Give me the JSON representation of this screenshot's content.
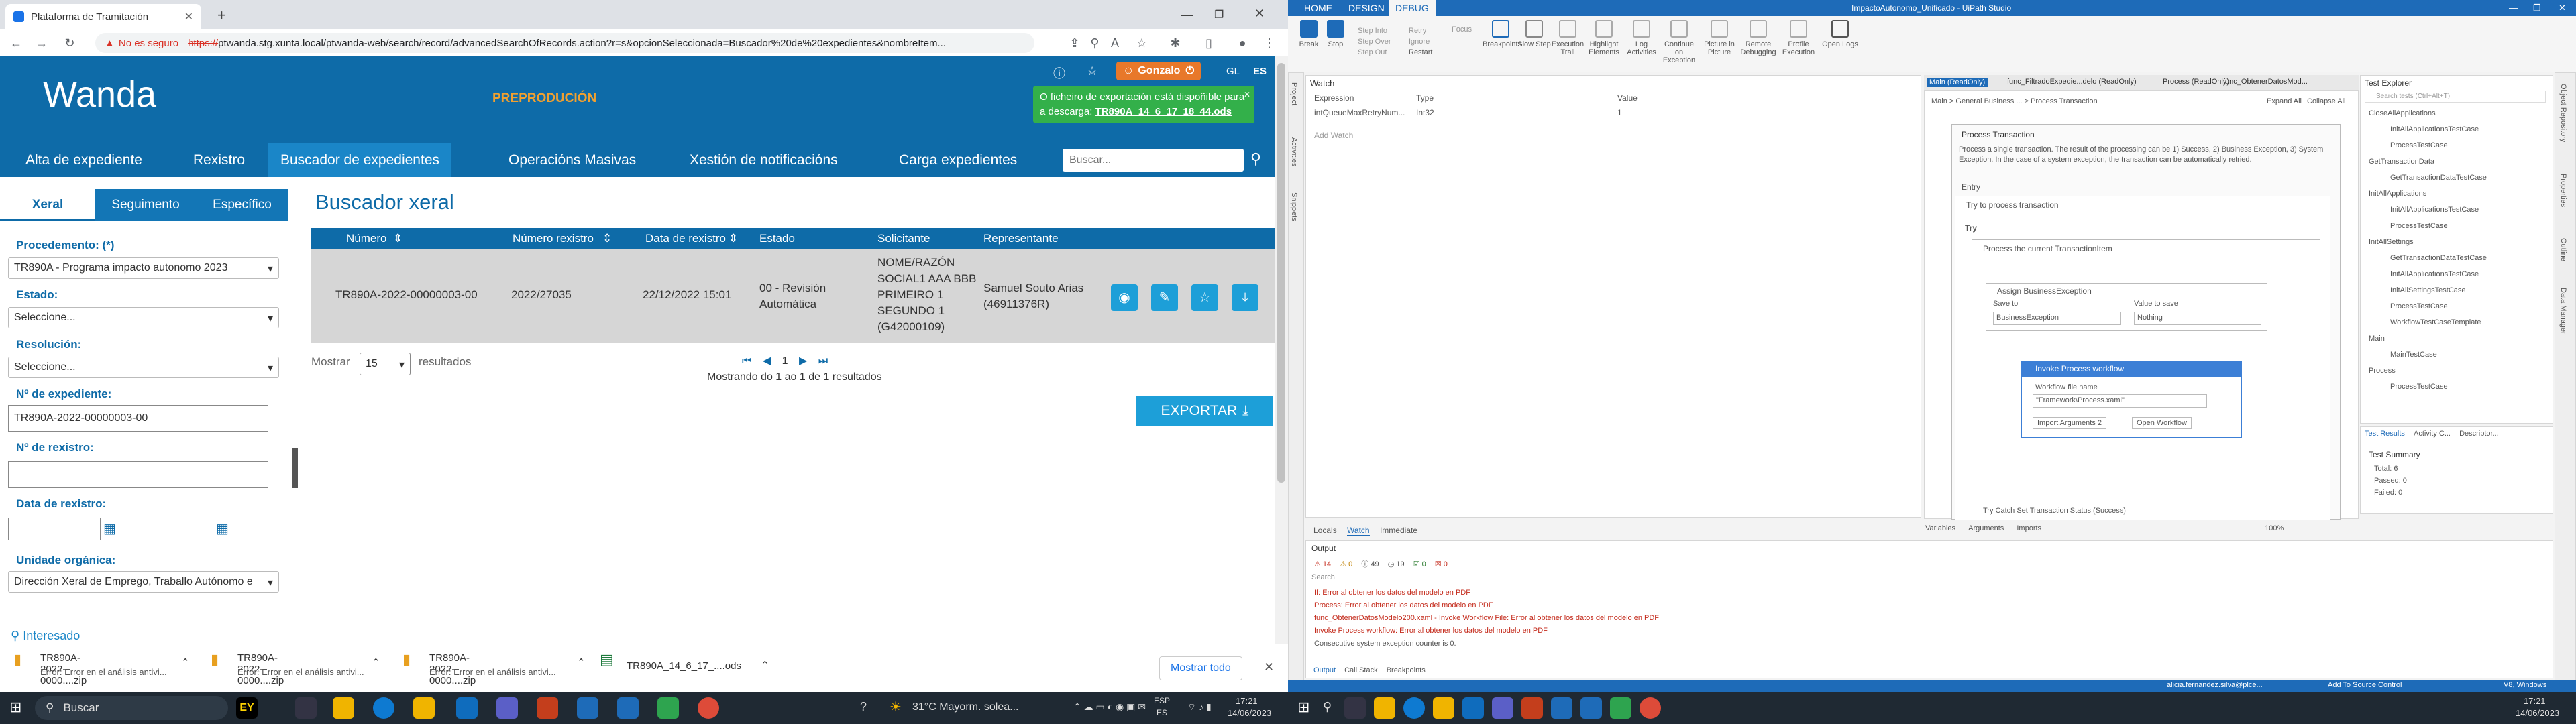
{
  "browser": {
    "tab_title": "Plataforma de Tramitación",
    "not_secure": "No es seguro",
    "url_prefix": "https://",
    "url": "ptwanda.stg.xunta.local/ptwanda-web/search/record/advancedSearchOfRecords.action?r=s&opcionSeleccionada=Buscador%20de%20expedientes&nombreItem..."
  },
  "wanda": {
    "logo": "Wanda",
    "env": "PREPRODUCIÓN",
    "user": "Gonzalo",
    "lang_gl": "GL",
    "lang_es": "ES",
    "notification": {
      "text": "O ficheiro de exportación está dispoñible para a descarga:",
      "file": "TR890A_14_6_17_18_44.ods"
    },
    "nav": [
      "Alta de expediente",
      "Rexistro",
      "Buscador de expedientes",
      "Operacións Masivas",
      "Xestión de notificacións",
      "Carga expedientes"
    ],
    "search_placeholder": "Buscar...",
    "side_tabs": [
      "Xeral",
      "Seguimento",
      "Específico"
    ],
    "filters": {
      "procedimento_label": "Procedemento: (*)",
      "procedimento_value": "TR890A - Programa impacto autonomo 2023",
      "estado_label": "Estado:",
      "estado_value": "Seleccione...",
      "resolucion_label": "Resolución:",
      "resolucion_value": "Seleccione...",
      "expediente_label": "Nº de expediente:",
      "expediente_value": "TR890A-2022-00000003-00",
      "rexistro_label": "Nº de rexistro:",
      "data_label": "Data de rexistro:",
      "unidade_label": "Unidade orgánica:",
      "unidade_value": "Dirección Xeral de Emprego, Traballo Autónomo e",
      "interesado": "Interesado"
    },
    "page_title": "Buscador xeral",
    "table": {
      "headers": [
        "Número",
        "Número rexistro",
        "Data de rexistro",
        "Estado",
        "Solicitante",
        "Representante"
      ],
      "row": {
        "numero": "TR890A-2022-00000003-00",
        "rexistro": "2022/27035",
        "data": "22/12/2022 15:01",
        "estado": "00 - Revisión Automática",
        "solicitante": "NOME/RAZÓN SOCIAL1 AAA BBB PRIMEIRO 1 SEGUNDO 1 (G42000109)",
        "representante": "Samuel Souto Arias (46911376R)"
      }
    },
    "mostrar": "Mostrar",
    "page_size": "15",
    "resultados": "resultados",
    "page_num": "1",
    "showing": "Mostrando do 1 ao 1 de 1 resultados",
    "export": "EXPORTAR"
  },
  "downloads": {
    "items": [
      {
        "name": "TR890A-2022-0000....zip",
        "status": "Error: Error en el análisis antivi..."
      },
      {
        "name": "TR890A-2022-0000....zip",
        "status": "Error: Error en el análisis antivi..."
      },
      {
        "name": "TR890A-2022-0000....zip",
        "status": "Error: Error en el análisis antivi..."
      },
      {
        "name": "TR890A_14_6_17_....ods",
        "status": ""
      }
    ],
    "show_all": "Mostrar todo"
  },
  "studio": {
    "title": "ImpactoAutonomo_Unificado - UiPath Studio",
    "tabs": [
      "HOME",
      "DESIGN",
      "DEBUG"
    ],
    "ribbon": [
      "Break",
      "Stop",
      "Step Into",
      "Step Over",
      "Step Out",
      "Retry",
      "Ignore",
      "Restart",
      "Focus",
      "Breakpoints",
      "Slow Step",
      "Execution Trail",
      "Highlight Elements",
      "Log Activities",
      "Continue on Exception",
      "Picture in Picture",
      "Remote Debugging",
      "Profile Execution",
      "Open Logs"
    ],
    "watch": {
      "title": "Watch",
      "cols": [
        "Expression",
        "Type",
        "Value"
      ],
      "row": [
        "intQueueMaxRetryNum...",
        "Int32",
        "1"
      ],
      "add": "Add Watch"
    },
    "bottom_tabs": [
      "Locals",
      "Watch",
      "Immediate"
    ],
    "doc_tabs": [
      "Main (ReadOnly)",
      "func_FiltradoExpedie...delo (ReadOnly)",
      "Process (ReadOnly)",
      "func_ObtenerDatosMod..."
    ],
    "breadcrumb": [
      "Main",
      "General Business ...",
      "Process Transaction"
    ],
    "expand": "Expand All",
    "collapse": "Collapse All",
    "wf": {
      "title": "Process Transaction",
      "desc": "Process a single transaction. The result of the processing can be 1) Success, 2) Business Exception, 3) System Exception. In the case of a system exception, the transaction can be automatically retried.",
      "entry": "Entry",
      "try_process": "Try to process transaction",
      "try": "Try",
      "process_current": "Process the current TransactionItem",
      "assign": "Assign BusinessException",
      "save_to": "Save to",
      "value_to_save": "Value to save",
      "save_val": "BusinessException",
      "value_val": "Nothing",
      "invoke": "Invoke Process workflow",
      "wf_file": "Workflow file name",
      "wf_path": "\"Framework\\Process.xaml\"",
      "import": "Import Arguments",
      "import_n": "2",
      "open": "Open Workflow",
      "trycatch": "Try Catch Set Transaction Status (Success)"
    },
    "designer_bottom": [
      "Variables",
      "Arguments",
      "Imports"
    ],
    "zoom": "100%",
    "output": {
      "title": "Output",
      "counts": [
        "14",
        "0",
        "49",
        "19",
        "0",
        "0"
      ],
      "search": "Search",
      "lines": [
        "If: Error al obtener los datos del modelo en PDF",
        "Process: Error al obtener los datos del modelo en PDF",
        "func_ObtenerDatosModelo200.xaml - Invoke Workflow File: Error al obtener los datos del modelo en PDF",
        "Invoke Process workflow: Error al obtener los datos del modelo en PDF",
        "Consecutive system exception counter is 0."
      ],
      "tabs": [
        "Output",
        "Call Stack",
        "Breakpoints"
      ]
    },
    "test_explorer": {
      "title": "Test Explorer",
      "search": "Search tests (Ctrl+Alt+T)",
      "tree": [
        "CloseAllApplications",
        "InitAllApplicationsTestCase",
        "ProcessTestCase",
        "GetTransactionData",
        "GetTransactionDataTestCase",
        "InitAllApplications",
        "InitAllApplicationsTestCase",
        "ProcessTestCase",
        "InitAllSettings",
        "GetTransactionDataTestCase",
        "InitAllApplicationsTestCase",
        "InitAllSettingsTestCase",
        "ProcessTestCase",
        "WorkflowTestCaseTemplate",
        "Main",
        "MainTestCase",
        "Process",
        "ProcessTestCase"
      ],
      "tabs": [
        "Test Results",
        "Activity C...",
        "Descriptor..."
      ],
      "summary": "Test Summary",
      "total": "Total: 6",
      "passed": "Passed: 0",
      "failed": "Failed: 0"
    },
    "side_tabs": [
      "Project",
      "Activities",
      "Snippets"
    ],
    "right_tabs": [
      "Object Repository",
      "Properties",
      "Outline",
      "Data Manager"
    ],
    "status": {
      "user": "alicia.fernandez.silva@plce...",
      "source": "Add To Source Control",
      "domain": "V8, Windows"
    }
  },
  "taskbar": {
    "search": "Buscar",
    "weather": "31°C  Mayorm. solea...",
    "lang": "ESP",
    "lang2": "ES",
    "time": "17:21",
    "date": "14/06/2023",
    "time2": "17:21",
    "date2": "14/06/2023"
  }
}
